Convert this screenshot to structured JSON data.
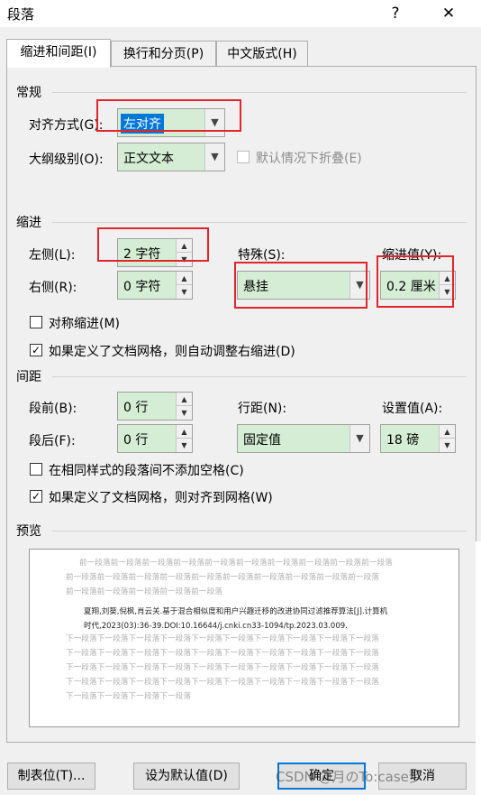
{
  "window": {
    "title": "段落",
    "help_glyph": "?",
    "close_glyph": "✕"
  },
  "tabs": [
    {
      "label": "缩进和间距(I)"
    },
    {
      "label": "换行和分页(P)"
    },
    {
      "label": "中文版式(H)"
    }
  ],
  "general": {
    "heading": "常规",
    "alignment_label": "对齐方式(G):",
    "alignment_value": "左对齐",
    "outline_label": "大纲级别(O):",
    "outline_value": "正文文本",
    "collapse_label": "默认情况下折叠(E)"
  },
  "indent": {
    "heading": "缩进",
    "left_label": "左侧(L):",
    "left_value": "2 字符",
    "right_label": "右侧(R):",
    "right_value": "0 字符",
    "special_label": "特殊(S):",
    "special_value": "悬挂",
    "by_label": "缩进值(Y):",
    "by_value": "0.2 厘米",
    "mirror_label": "对称缩进(M)",
    "auto_adjust_label": "如果定义了文档网格，则自动调整右缩进(D)"
  },
  "spacing": {
    "heading": "间距",
    "before_label": "段前(B):",
    "before_value": "0 行",
    "after_label": "段后(F):",
    "after_value": "0 行",
    "line_label": "行距(N):",
    "line_value": "固定值",
    "at_label": "设置值(A):",
    "at_value": "18 磅",
    "no_space_label": "在相同样式的段落间不添加空格(C)",
    "snap_grid_label": "如果定义了文档网格，则对齐到网格(W)"
  },
  "preview": {
    "heading": "预览",
    "prev_lines": [
      "前一段落前一段落前一段落前一段落前一段落前一段落前一段落前一段落前一段落前一段落",
      "前一段落前一段落前一段落前一段落前一段落前一段落前一段落前一段落前一段落前一段落",
      "前一段落前一段落前一段落前一段落前一段落"
    ],
    "main_lines": [
      "夏翔,刘葵,倪枫,肖云关.基于混合相似度和用户兴趣迁移的改进协同过滤推荐算法[J].计算机",
      "时代,2023(03):36-39.DOI:10.16644/j.cnki.cn33-1094/tp.2023.03.009."
    ],
    "next_lines": [
      "下一段落下一段落下一段落下一段落下一段落下一段落下一段落下一段落下一段落下一段落",
      "下一段落下一段落下一段落下一段落下一段落下一段落下一段落下一段落下一段落下一段落",
      "下一段落下一段落下一段落下一段落下一段落下一段落下一段落下一段落下一段落下一段落",
      "下一段落下一段落下一段落下一段落下一段落下一段落下一段落下一段落下一段落下一段落",
      "下一段落下一段落下一段落下一段落"
    ]
  },
  "buttons": {
    "tabs_label": "制表位(T)...",
    "default_label": "设为默认值(D)",
    "ok_label": "确定",
    "cancel_label": "取消"
  },
  "watermark": "CSDN @月のTo:case梦",
  "colors": {
    "accent": "#0078d7",
    "highlight": "#e0262c",
    "field_bg": "#d4edd4"
  }
}
